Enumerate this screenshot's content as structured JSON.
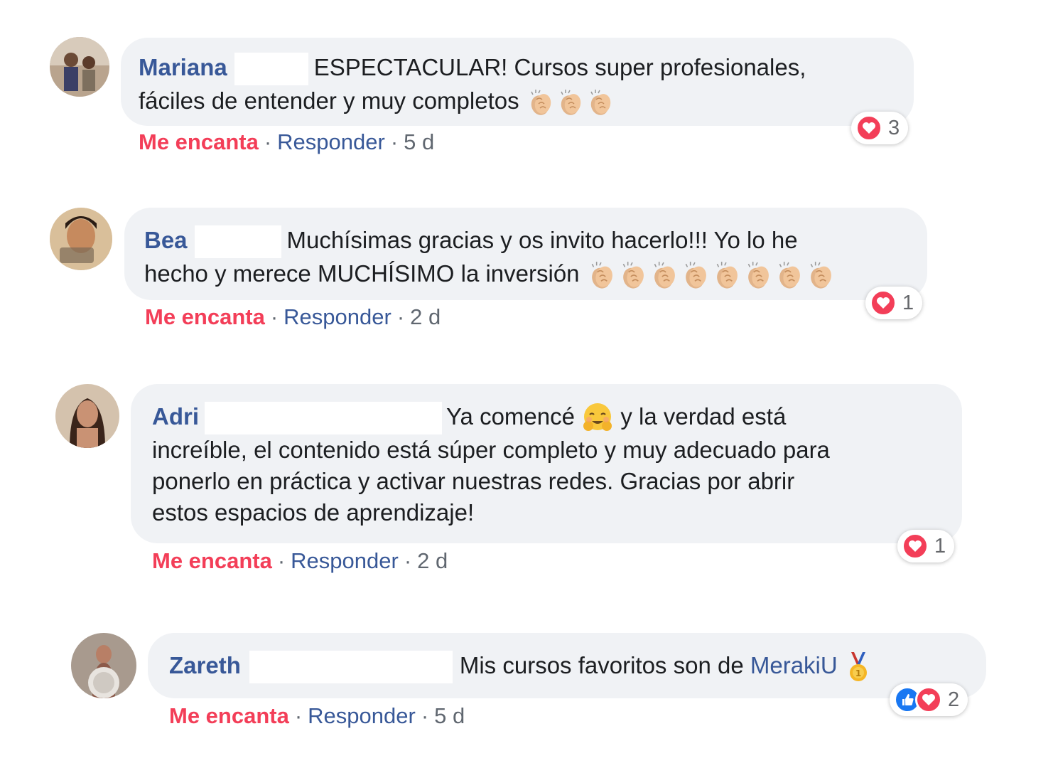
{
  "comments": [
    {
      "author": "Mariana",
      "text_line1": "ESPECTACULAR! Cursos super profesionales,",
      "text_line2": "fáciles de entender y muy completos",
      "emojis": [
        "clapping-hands",
        "clapping-hands",
        "clapping-hands"
      ],
      "love_label": "Me encanta",
      "reply_label": "Responder",
      "time": "5 d",
      "reactions": {
        "types": [
          "love"
        ],
        "count": "3"
      }
    },
    {
      "author": "Bea",
      "text_line1": "Muchísimas gracias y os invito hacerlo!!! Yo lo he",
      "text_line2": "hecho y merece MUCHÍSIMO la inversión",
      "emojis": [
        "clapping-hands",
        "clapping-hands",
        "clapping-hands",
        "clapping-hands",
        "clapping-hands",
        "clapping-hands",
        "clapping-hands",
        "clapping-hands"
      ],
      "love_label": "Me encanta",
      "reply_label": "Responder",
      "time": "2 d",
      "reactions": {
        "types": [
          "love"
        ],
        "count": "1"
      }
    },
    {
      "author": "Adri",
      "text_line1a": "Ya comencé",
      "text_line1b": "y la verdad está",
      "text_line2": "increíble, el contenido está súper completo y muy adecuado para",
      "text_line3": "ponerlo en práctica y activar nuestras redes. Gracias por abrir",
      "text_line4": "estos espacios de aprendizaje!",
      "emojis": [
        "hugging-face"
      ],
      "love_label": "Me encanta",
      "reply_label": "Responder",
      "time": "2 d",
      "reactions": {
        "types": [
          "love"
        ],
        "count": "1"
      }
    },
    {
      "author": "Zareth",
      "text": "Mis cursos favoritos son de",
      "mention": "MerakiU",
      "emojis": [
        "first-place-medal"
      ],
      "love_label": "Me encanta",
      "reply_label": "Responder",
      "time": "5 d",
      "reactions": {
        "types": [
          "like",
          "love"
        ],
        "count": "2"
      }
    }
  ],
  "colors": {
    "bubble": "#f0f2f5",
    "name": "#385898",
    "love": "#f33e58",
    "like": "#1877f2",
    "meta": "#606770"
  }
}
